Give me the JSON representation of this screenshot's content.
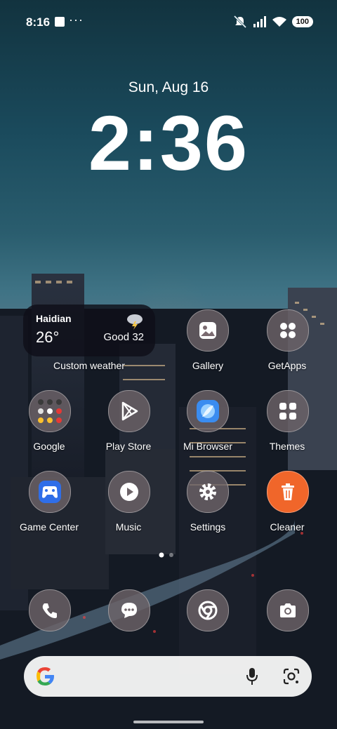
{
  "status_bar": {
    "time": "8:16",
    "more": "···",
    "battery": "100"
  },
  "lock": {
    "date": "Sun, Aug 16",
    "time": "2:36"
  },
  "weather_widget": {
    "city": "Haidian",
    "temp": "26°",
    "aqi": "Good 32",
    "label": "Custom weather"
  },
  "apps": {
    "gallery": "Gallery",
    "getapps": "GetApps",
    "google": "Google",
    "playstore": "Play Store",
    "mibrowser": "Mi Browser",
    "themes": "Themes",
    "gamecenter": "Game Center",
    "music": "Music",
    "settings": "Settings",
    "cleaner": "Cleaner"
  },
  "colors": {
    "accent_cleaner": "#f0662a",
    "accent_browser": "#3a8cf0",
    "accent_game": "#2f6ee8"
  }
}
